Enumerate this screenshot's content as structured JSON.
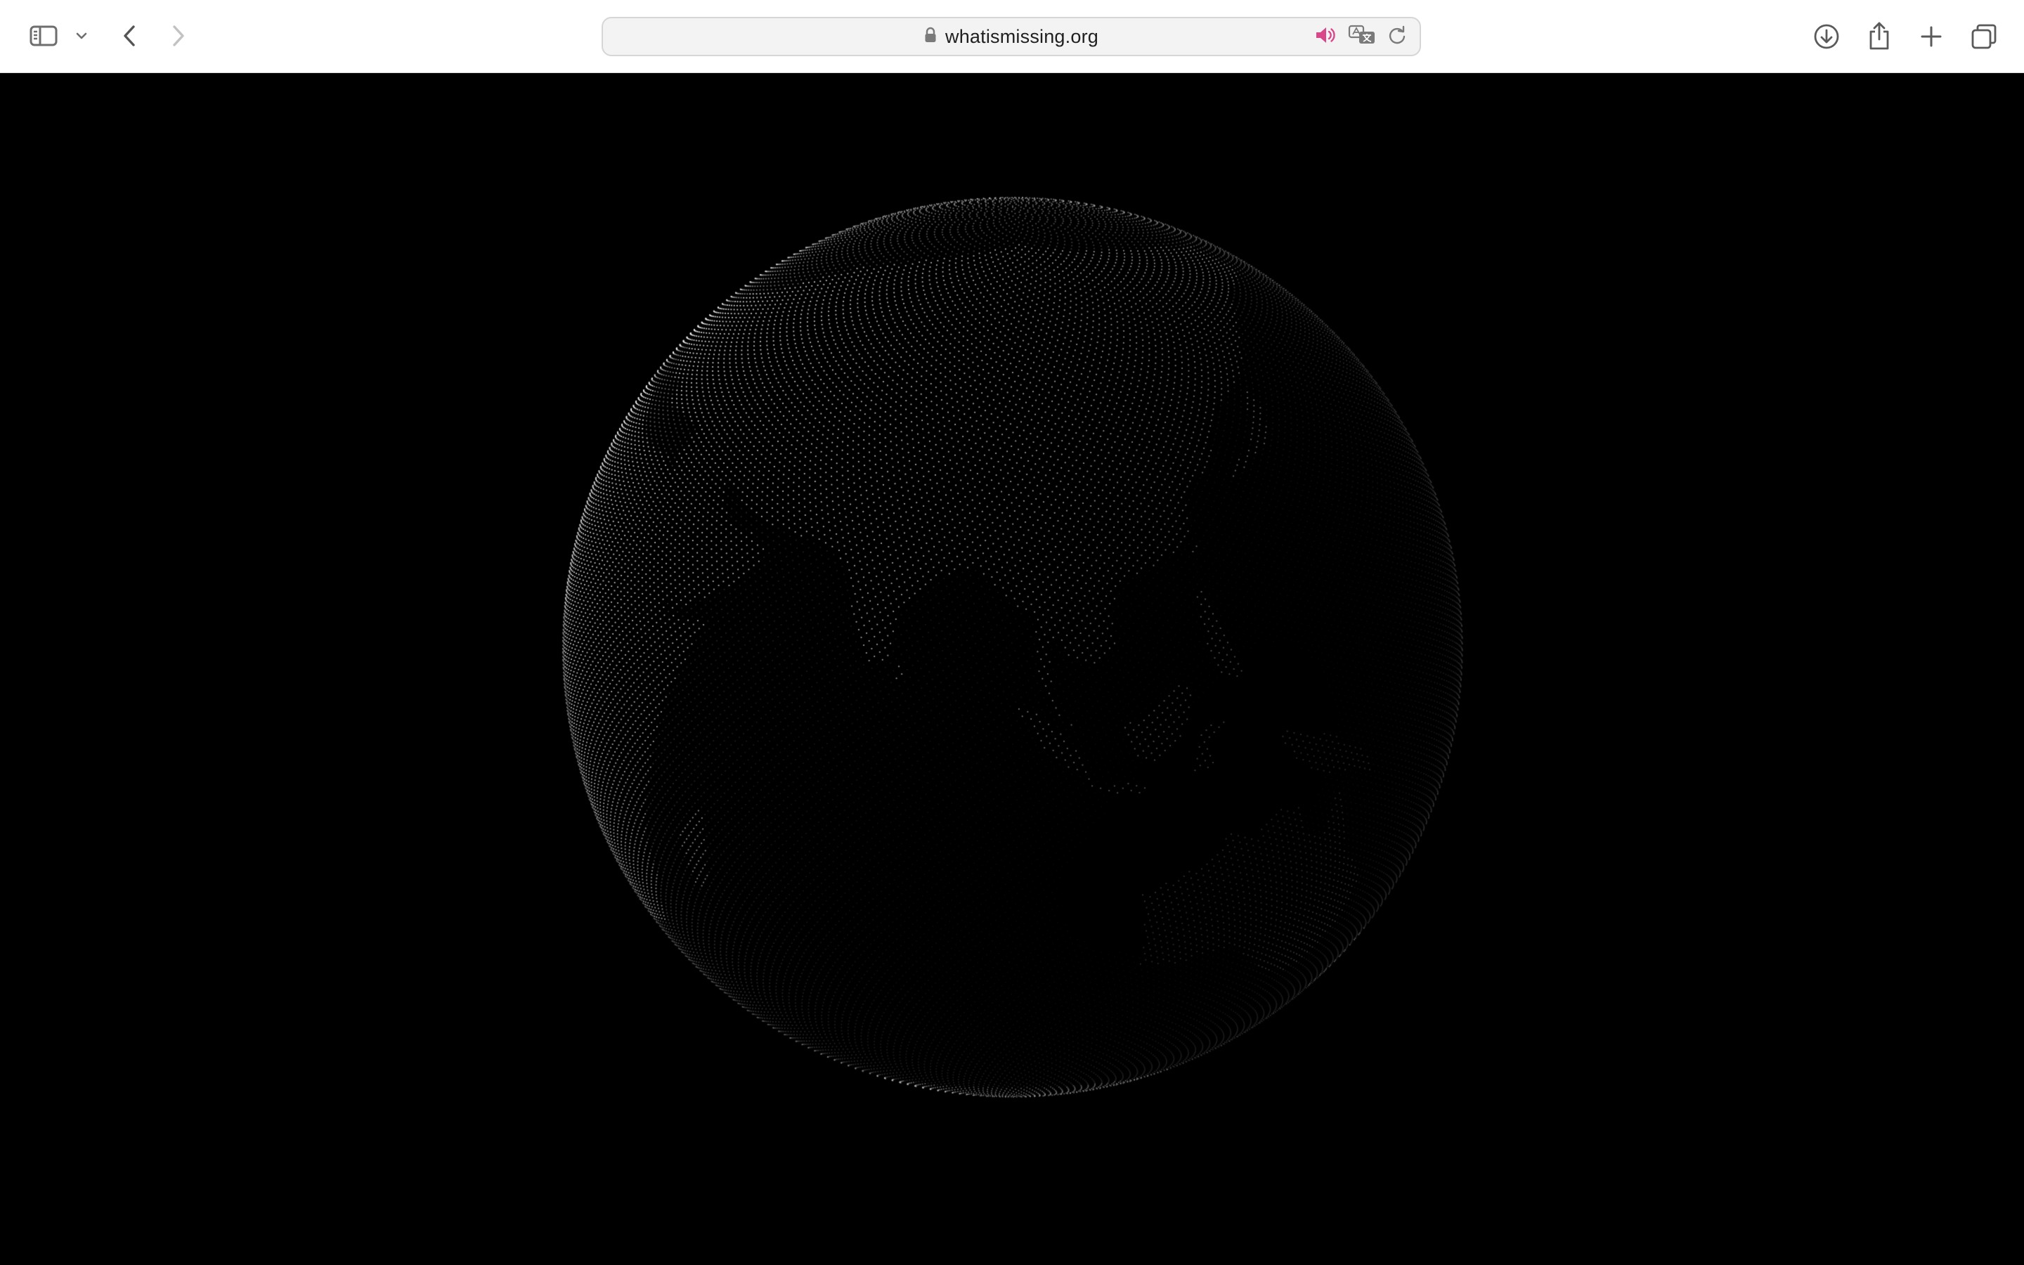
{
  "browser": {
    "url": "whatismissing.org",
    "secure": true,
    "audio_playing": true,
    "accent_color": "#d9468a",
    "toolbar_icons": [
      "sidebar-icon",
      "chevron-down-icon",
      "back-arrow-icon",
      "forward-arrow-icon",
      "lock-icon",
      "speaker-icon",
      "translate-icon",
      "reload-icon",
      "download-icon",
      "share-icon",
      "plus-icon",
      "tabs-overview-icon"
    ]
  },
  "page": {
    "background_color": "#000000",
    "visual": "point-cloud-globe"
  }
}
